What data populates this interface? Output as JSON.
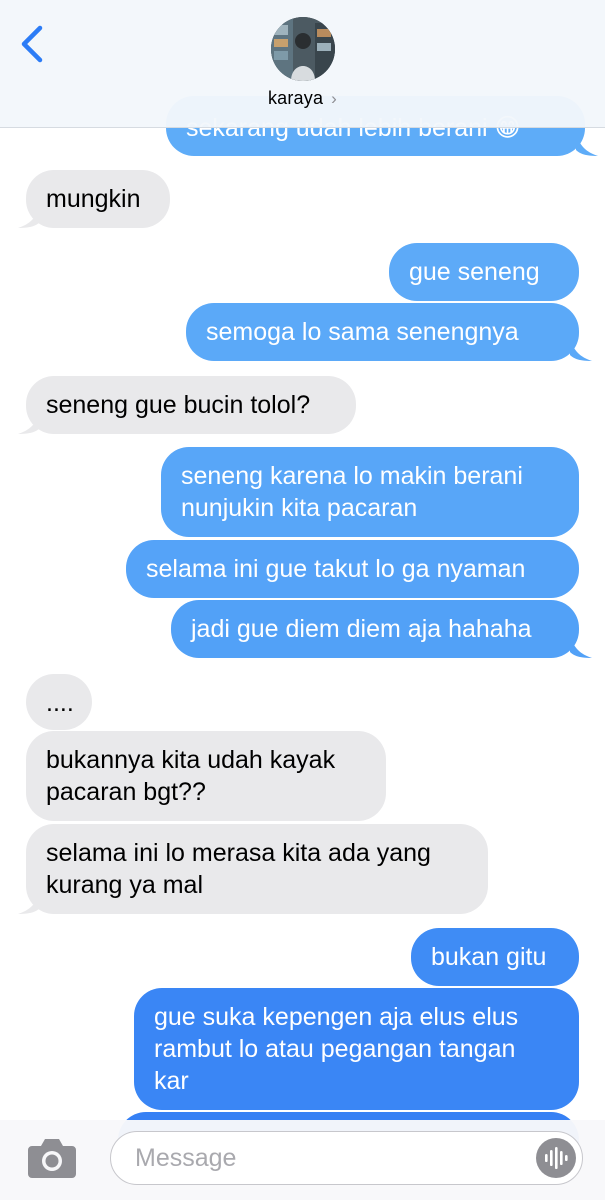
{
  "header": {
    "contact_name": "karaya",
    "chevron": "›",
    "back_icon": "chevron-left-icon",
    "accent_color": "#2c7cf6"
  },
  "messages": [
    {
      "side": "out",
      "text": "sekarang udah lebih berani 😁"
    },
    {
      "side": "in",
      "text": "mungkin"
    },
    {
      "side": "out",
      "text": "gue seneng"
    },
    {
      "side": "out",
      "text": "semoga lo sama senengnya"
    },
    {
      "side": "in",
      "text": "seneng gue bucin tolol?"
    },
    {
      "side": "out",
      "text": "seneng karena lo makin berani\nnunjukin kita pacaran"
    },
    {
      "side": "out",
      "text": "selama ini gue takut lo ga nyaman"
    },
    {
      "side": "out",
      "text": "jadi gue diem diem aja hahaha"
    },
    {
      "side": "in",
      "text": "...."
    },
    {
      "side": "in",
      "text": "bukannya kita udah kayak\npacaran bgt??"
    },
    {
      "side": "in",
      "text": "selama ini lo merasa kita ada yang\nkurang ya mal"
    },
    {
      "side": "out",
      "text": "bukan gitu"
    },
    {
      "side": "out",
      "text": "gue suka kepengen aja elus elus\nrambut lo atau pegangan tangan\nkar"
    }
  ],
  "composer": {
    "placeholder": "Message",
    "camera_icon": "camera-icon",
    "voice_icon": "waveform-icon"
  },
  "colors": {
    "incoming_bubble": "#e9e9eb",
    "outgoing_top": "#5aa9f7",
    "outgoing_bottom": "#2f7bf3"
  }
}
